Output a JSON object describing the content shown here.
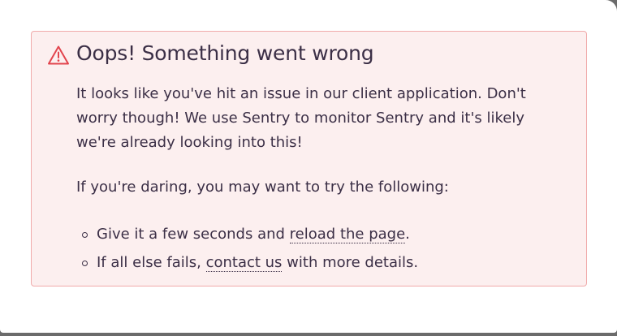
{
  "error": {
    "icon": "warning-triangle-icon",
    "title": "Oops! Something went wrong",
    "message": "It looks like you've hit an issue in our client application. Don't worry though! We use Sentry to monitor Sentry and it's likely we're already looking into this!",
    "suggestion_intro": "If you're daring, you may want to try the following:",
    "suggestions": [
      {
        "prefix": "Give it a few seconds and ",
        "link": "reload the page",
        "suffix": "."
      },
      {
        "prefix": "If all else fails, ",
        "link": "contact us",
        "suffix": " with more details."
      }
    ]
  },
  "colors": {
    "alert_background": "#fcefef",
    "alert_border": "#f0aaaa",
    "icon": "#e2444d",
    "text": "#3b2f46"
  }
}
